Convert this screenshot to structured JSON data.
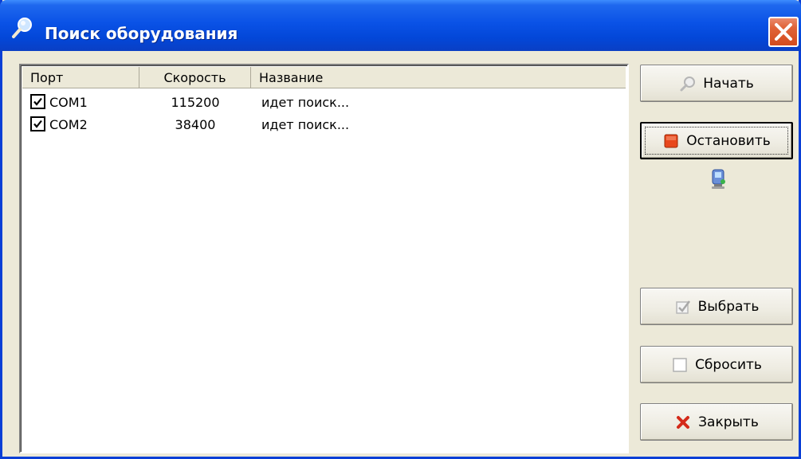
{
  "window": {
    "title": "Поиск оборудования",
    "title_icon": "search-magnifier-icon",
    "close_icon": "close-x-icon"
  },
  "list": {
    "columns": [
      "Порт",
      "Скорость",
      "Название"
    ],
    "rows": [
      {
        "checked": true,
        "port": "COM1",
        "speed": "115200",
        "name": "идет поиск..."
      },
      {
        "checked": true,
        "port": "COM2",
        "speed": "38400",
        "name": "идет поиск..."
      }
    ]
  },
  "buttons": {
    "start": {
      "label": "Начать",
      "icon": "magnifier-icon"
    },
    "stop": {
      "label": "Остановить",
      "icon": "stop-square-icon"
    },
    "select": {
      "label": "Выбрать",
      "icon": "check-icon"
    },
    "reset": {
      "label": "Сбросить",
      "icon": "empty-checkbox-icon"
    },
    "close": {
      "label": "Закрыть",
      "icon": "red-x-icon"
    }
  },
  "status": {
    "icon": "network-computer-icon"
  },
  "colors": {
    "titlebar": "#0a52e6",
    "window_bg": "#ece9d8",
    "close_button": "#e06338",
    "stop_icon": "#e8471c"
  }
}
